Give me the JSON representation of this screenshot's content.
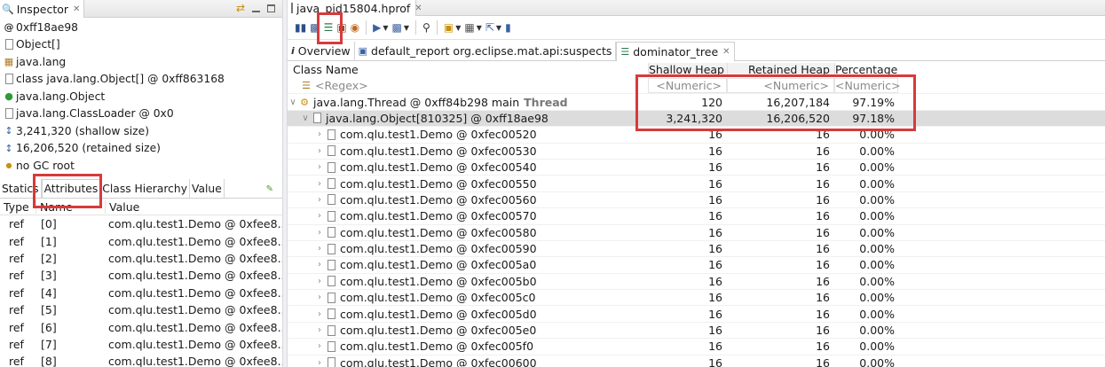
{
  "inspector": {
    "view_title": "Inspector",
    "object_address": "0xff18ae98",
    "class_name": "Object[]",
    "package": "java.lang",
    "class_object": "class java.lang.Object[] @ 0xff863168",
    "super_class": "java.lang.Object",
    "class_loader": "java.lang.ClassLoader @ 0x0",
    "shallow_size": "3,241,320 (shallow size)",
    "retained_size": "16,206,520 (retained size)",
    "gc_root": "no GC root",
    "tabs": [
      "Statics",
      "Attributes",
      "Class Hierarchy",
      "Value"
    ],
    "active_tab": "Attributes",
    "table": {
      "headers": [
        "Type",
        "Name",
        "Value"
      ],
      "rows": [
        {
          "type": "ref",
          "name": "[0]",
          "value": "com.qlu.test1.Demo @ 0xfee8..."
        },
        {
          "type": "ref",
          "name": "[1]",
          "value": "com.qlu.test1.Demo @ 0xfee8..."
        },
        {
          "type": "ref",
          "name": "[2]",
          "value": "com.qlu.test1.Demo @ 0xfee8..."
        },
        {
          "type": "ref",
          "name": "[3]",
          "value": "com.qlu.test1.Demo @ 0xfee8..."
        },
        {
          "type": "ref",
          "name": "[4]",
          "value": "com.qlu.test1.Demo @ 0xfee8..."
        },
        {
          "type": "ref",
          "name": "[5]",
          "value": "com.qlu.test1.Demo @ 0xfee8..."
        },
        {
          "type": "ref",
          "name": "[6]",
          "value": "com.qlu.test1.Demo @ 0xfee8..."
        },
        {
          "type": "ref",
          "name": "[7]",
          "value": "com.qlu.test1.Demo @ 0xfee8..."
        },
        {
          "type": "ref",
          "name": "[8]",
          "value": "com.qlu.test1.Demo @ 0xfee8..."
        }
      ]
    }
  },
  "editor": {
    "file_tab": "java_pid15804.hprof",
    "tabs": [
      {
        "label": "Overview",
        "icon": "info-icon"
      },
      {
        "label": "default_report  org.eclipse.mat.api:suspects",
        "icon": "report-icon"
      },
      {
        "label": "dominator_tree",
        "icon": "dominator-tree-icon"
      }
    ],
    "active_tab": "dominator_tree",
    "columns": [
      "Class Name",
      "Shallow Heap",
      "Retained Heap",
      "Percentage"
    ],
    "filter": {
      "name": "<Regex>",
      "shallow": "<Numeric>",
      "retained": "<Numeric>",
      "percentage": "<Numeric>"
    },
    "thread_row": {
      "name": "java.lang.Thread @ 0xff84b298  main",
      "tag": "Thread",
      "shallow": "120",
      "retained": "16,207,184",
      "percentage": "97.19%"
    },
    "array_row": {
      "name": "java.lang.Object[810325] @ 0xff18ae98",
      "shallow": "3,241,320",
      "retained": "16,206,520",
      "percentage": "97.18%"
    },
    "children": [
      {
        "name": "com.qlu.test1.Demo @ 0xfec00520",
        "shallow": "16",
        "retained": "16",
        "percentage": "0.00%"
      },
      {
        "name": "com.qlu.test1.Demo @ 0xfec00530",
        "shallow": "16",
        "retained": "16",
        "percentage": "0.00%"
      },
      {
        "name": "com.qlu.test1.Demo @ 0xfec00540",
        "shallow": "16",
        "retained": "16",
        "percentage": "0.00%"
      },
      {
        "name": "com.qlu.test1.Demo @ 0xfec00550",
        "shallow": "16",
        "retained": "16",
        "percentage": "0.00%"
      },
      {
        "name": "com.qlu.test1.Demo @ 0xfec00560",
        "shallow": "16",
        "retained": "16",
        "percentage": "0.00%"
      },
      {
        "name": "com.qlu.test1.Demo @ 0xfec00570",
        "shallow": "16",
        "retained": "16",
        "percentage": "0.00%"
      },
      {
        "name": "com.qlu.test1.Demo @ 0xfec00580",
        "shallow": "16",
        "retained": "16",
        "percentage": "0.00%"
      },
      {
        "name": "com.qlu.test1.Demo @ 0xfec00590",
        "shallow": "16",
        "retained": "16",
        "percentage": "0.00%"
      },
      {
        "name": "com.qlu.test1.Demo @ 0xfec005a0",
        "shallow": "16",
        "retained": "16",
        "percentage": "0.00%"
      },
      {
        "name": "com.qlu.test1.Demo @ 0xfec005b0",
        "shallow": "16",
        "retained": "16",
        "percentage": "0.00%"
      },
      {
        "name": "com.qlu.test1.Demo @ 0xfec005c0",
        "shallow": "16",
        "retained": "16",
        "percentage": "0.00%"
      },
      {
        "name": "com.qlu.test1.Demo @ 0xfec005d0",
        "shallow": "16",
        "retained": "16",
        "percentage": "0.00%"
      },
      {
        "name": "com.qlu.test1.Demo @ 0xfec005e0",
        "shallow": "16",
        "retained": "16",
        "percentage": "0.00%"
      },
      {
        "name": "com.qlu.test1.Demo @ 0xfec005f0",
        "shallow": "16",
        "retained": "16",
        "percentage": "0.00%"
      },
      {
        "name": "com.qlu.test1.Demo @ 0xfec00600",
        "shallow": "16",
        "retained": "16",
        "percentage": "0.00%"
      }
    ]
  },
  "colors": {
    "annotation_red": "#d83a3a",
    "selection_gray": "#dcdcdc",
    "icon_blue": "#3a62a0"
  }
}
